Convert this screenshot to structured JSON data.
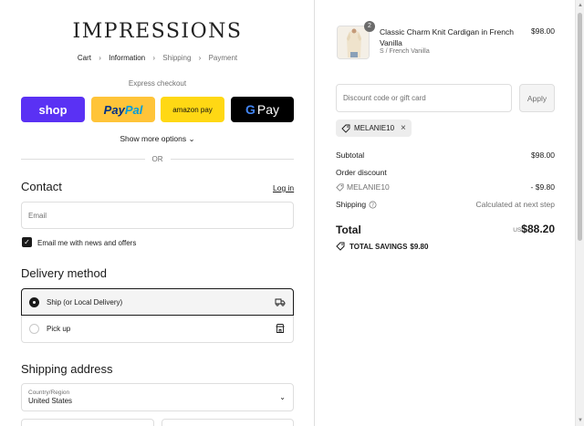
{
  "brand": {
    "logo_text": "IMPRESSIONS"
  },
  "breadcrumb": {
    "items": [
      "Cart",
      "Information",
      "Shipping",
      "Payment"
    ]
  },
  "express": {
    "label": "Express checkout",
    "shop_label": "shop",
    "paypal_label_1": "Pay",
    "paypal_label_2": "Pal",
    "amazon_label": "amazon pay",
    "gpay_g": "G",
    "gpay_label": "Pay",
    "show_more": "Show more options",
    "or_text": "OR"
  },
  "contact": {
    "title": "Contact",
    "login": "Log in",
    "email_placeholder": "Email",
    "newsletter_label": "Email me with news and offers",
    "newsletter_checked": true
  },
  "delivery": {
    "title": "Delivery method",
    "options": [
      {
        "label": "Ship (or Local Delivery)",
        "selected": true,
        "icon": "truck-icon"
      },
      {
        "label": "Pick up",
        "selected": false,
        "icon": "store-icon"
      }
    ]
  },
  "shipping": {
    "title": "Shipping address",
    "country_label": "Country/Region",
    "country_value": "United States"
  },
  "cart": {
    "item": {
      "quantity": "2",
      "title": "Classic Charm Knit Cardigan in French Vanilla",
      "variant": "S / French Vanilla",
      "price": "$98.00"
    },
    "discount_placeholder": "Discount code or gift card",
    "apply_label": "Apply",
    "applied_code": "MELANIE10"
  },
  "summary": {
    "subtotal_label": "Subtotal",
    "subtotal_value": "$98.00",
    "order_discount_label": "Order discount",
    "discount_code": "MELANIE10",
    "discount_value": "- $9.80",
    "shipping_label": "Shipping",
    "shipping_value": "Calculated at next step",
    "total_label": "Total",
    "currency": "USD",
    "total_value": "$88.20",
    "savings_label": "TOTAL SAVINGS",
    "savings_value": "$9.80"
  },
  "colors": {
    "shop_pay": "#5a31f4",
    "paypal": "#ffc439",
    "amazon_pay": "#ffd814",
    "google_pay": "#000000",
    "text": "#1a1a1a",
    "muted": "#707070"
  }
}
